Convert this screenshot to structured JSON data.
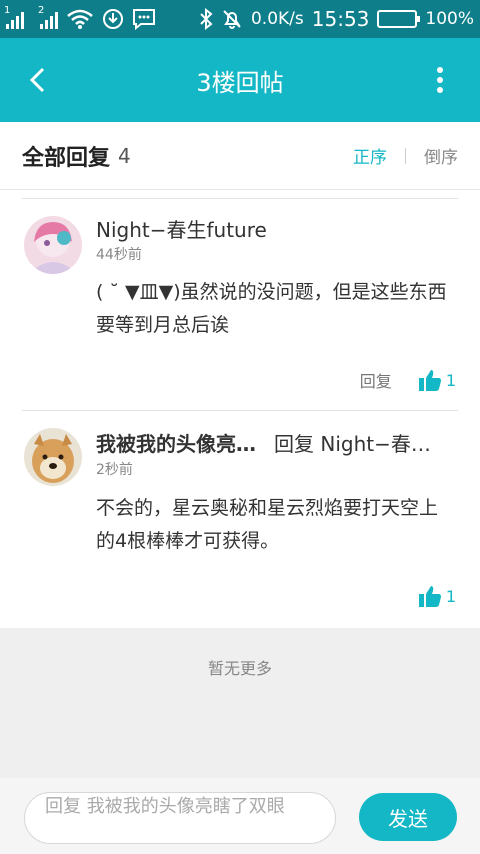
{
  "status_bar": {
    "sim1": "1",
    "sim2": "2",
    "speed": "0.0K/s",
    "time": "15:53",
    "battery": "100%",
    "battery_level": 1.0
  },
  "header": {
    "title": "3楼回帖"
  },
  "replies_header": {
    "label": "全部回复",
    "count": "4",
    "sort_asc": "正序",
    "sort_desc": "倒序"
  },
  "replies": [
    {
      "username": "Night−春生future",
      "time": "44秒前",
      "content": "( ˘ ▼皿▼)虽然说的没问题，但是这些东西要等到月总后诶",
      "reply_label": "回复",
      "likes": "1"
    },
    {
      "username": "我被我的头像亮…",
      "reply_to": "回复 Night−春…",
      "time": "2秒前",
      "content": "不会的，星云奥秘和星云烈焰要打天空上的4根棒棒才可获得。",
      "likes": "1"
    }
  ],
  "no_more": "暂无更多",
  "composer": {
    "placeholder": "回复 我被我的头像亮瞎了双眼",
    "send": "发送"
  },
  "colors": {
    "status_bar": "#0e7f8a",
    "accent": "#14b7c5"
  }
}
